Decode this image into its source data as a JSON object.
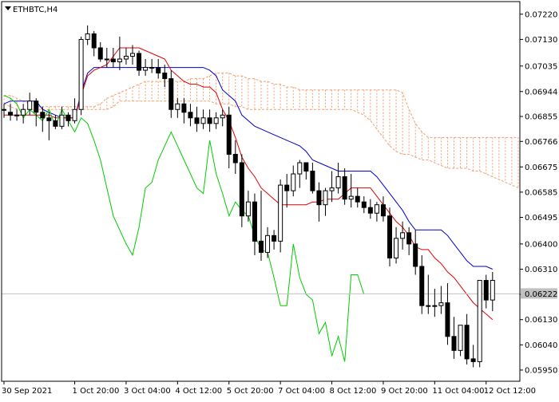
{
  "chart_data": {
    "type": "candlestick",
    "symbol_label": "ETHBTC,H4",
    "indicators": [
      "Ichimoku Kinko Hyo"
    ],
    "ylim": [
      0.0591,
      0.07265
    ],
    "y_ticks": [
      "0.07220",
      "0.07130",
      "0.07035",
      "0.06944",
      "0.06855",
      "0.06766",
      "0.06675",
      "0.06585",
      "0.06495",
      "0.06400",
      "0.06310",
      "0.06220",
      "0.06130",
      "0.06040",
      "0.05950"
    ],
    "x_ticks": [
      {
        "label": "30 Sep 2021",
        "bar": 0
      },
      {
        "label": "1 Oct 20:00",
        "bar": 11
      },
      {
        "label": "3 Oct 04:00",
        "bar": 19
      },
      {
        "label": "4 Oct 12:00",
        "bar": 27
      },
      {
        "label": "5 Oct 20:00",
        "bar": 35
      },
      {
        "label": "7 Oct 04:00",
        "bar": 43
      },
      {
        "label": "8 Oct 12:00",
        "bar": 51
      },
      {
        "label": "9 Oct 20:00",
        "bar": 59
      },
      {
        "label": "11 Oct 04:00",
        "bar": 67
      },
      {
        "label": "12 Oct 12:00",
        "bar": 75
      }
    ],
    "current_price": "0.06222",
    "candles": {
      "open": [
        0.0688,
        0.0687,
        0.0686,
        0.0686,
        0.0688,
        0.0691,
        0.0687,
        0.0685,
        0.0684,
        0.0682,
        0.0686,
        0.0684,
        0.0688,
        0.0713,
        0.0715,
        0.071,
        0.0706,
        0.0706,
        0.0705,
        0.0706,
        0.0707,
        0.0708,
        0.0702,
        0.0703,
        0.0703,
        0.0701,
        0.0699,
        0.0688,
        0.069,
        0.0687,
        0.0685,
        0.0683,
        0.0685,
        0.0683,
        0.0685,
        0.0686,
        0.0672,
        0.0669,
        0.065,
        0.0655,
        0.0641,
        0.0637,
        0.0643,
        0.0641,
        0.0661,
        0.0659,
        0.0665,
        0.0669,
        0.0666,
        0.0659,
        0.0654,
        0.0659,
        0.066,
        0.0664,
        0.0656,
        0.0657,
        0.0655,
        0.0653,
        0.0651,
        0.0654,
        0.065,
        0.0635,
        0.0642,
        0.0644,
        0.064,
        0.0632,
        0.0618,
        0.0618,
        0.0618,
        0.0619,
        0.0607,
        0.0602,
        0.0611,
        0.0599,
        0.0598,
        0.0627,
        0.062
      ],
      "close": [
        0.0688,
        0.0686,
        0.0686,
        0.0688,
        0.0691,
        0.0687,
        0.0685,
        0.0684,
        0.0682,
        0.0686,
        0.0684,
        0.0688,
        0.0713,
        0.0715,
        0.071,
        0.0706,
        0.0706,
        0.0705,
        0.0706,
        0.0707,
        0.0708,
        0.0702,
        0.0703,
        0.0703,
        0.0701,
        0.0699,
        0.0688,
        0.069,
        0.0687,
        0.0685,
        0.0683,
        0.0685,
        0.0683,
        0.0685,
        0.0686,
        0.0672,
        0.0669,
        0.065,
        0.0655,
        0.0641,
        0.0637,
        0.0643,
        0.0641,
        0.0661,
        0.0659,
        0.0665,
        0.0669,
        0.0666,
        0.0659,
        0.0654,
        0.0659,
        0.066,
        0.0664,
        0.0656,
        0.0657,
        0.0655,
        0.0653,
        0.0651,
        0.0654,
        0.065,
        0.0635,
        0.0642,
        0.0644,
        0.064,
        0.0632,
        0.0618,
        0.0618,
        0.0618,
        0.0619,
        0.0607,
        0.0602,
        0.0611,
        0.0599,
        0.0598,
        0.0627,
        0.062,
        0.0627
      ],
      "high": [
        0.069,
        0.069,
        0.0688,
        0.069,
        0.0694,
        0.0692,
        0.0689,
        0.0687,
        0.0686,
        0.0689,
        0.0687,
        0.0692,
        0.0714,
        0.0718,
        0.0716,
        0.0712,
        0.071,
        0.071,
        0.0714,
        0.071,
        0.0711,
        0.0709,
        0.0706,
        0.0706,
        0.0706,
        0.0704,
        0.0702,
        0.0692,
        0.0692,
        0.069,
        0.0689,
        0.0688,
        0.0688,
        0.0687,
        0.0688,
        0.0689,
        0.0677,
        0.0672,
        0.0659,
        0.0658,
        0.0659,
        0.0646,
        0.0645,
        0.0663,
        0.0665,
        0.0668,
        0.067,
        0.0669,
        0.0669,
        0.0662,
        0.066,
        0.0666,
        0.0669,
        0.0667,
        0.0665,
        0.066,
        0.0657,
        0.0656,
        0.0655,
        0.0657,
        0.0653,
        0.0646,
        0.0648,
        0.0646,
        0.0645,
        0.0636,
        0.0629,
        0.0624,
        0.0625,
        0.0626,
        0.0614,
        0.0608,
        0.0615,
        0.0604,
        0.0624,
        0.0629,
        0.063
      ],
      "low": [
        0.0685,
        0.0684,
        0.0684,
        0.0683,
        0.0686,
        0.0682,
        0.068,
        0.0677,
        0.0681,
        0.0681,
        0.0682,
        0.0683,
        0.0686,
        0.0711,
        0.0707,
        0.0705,
        0.0703,
        0.0703,
        0.0702,
        0.0704,
        0.0704,
        0.07,
        0.07,
        0.0701,
        0.0699,
        0.0696,
        0.0685,
        0.0685,
        0.0683,
        0.0682,
        0.068,
        0.0681,
        0.068,
        0.0681,
        0.0682,
        0.0667,
        0.0665,
        0.0646,
        0.0648,
        0.0636,
        0.0634,
        0.0635,
        0.0638,
        0.0637,
        0.0653,
        0.0657,
        0.066,
        0.0663,
        0.0658,
        0.0648,
        0.065,
        0.0655,
        0.0658,
        0.0654,
        0.0653,
        0.0653,
        0.0651,
        0.0649,
        0.0648,
        0.0648,
        0.0632,
        0.0633,
        0.0638,
        0.0636,
        0.0629,
        0.0615,
        0.0615,
        0.0614,
        0.0615,
        0.0604,
        0.0599,
        0.06,
        0.0597,
        0.0596,
        0.0596,
        0.0617,
        0.0616
      ]
    },
    "tenkan_sen": [
      0.0686,
      0.0686,
      0.0686,
      0.0686,
      0.0686,
      0.0686,
      0.0686,
      0.0686,
      0.0685,
      0.0685,
      0.0685,
      0.0685,
      0.0693,
      0.07,
      0.0702,
      0.0703,
      0.0704,
      0.0707,
      0.071,
      0.071,
      0.071,
      0.071,
      0.0709,
      0.0708,
      0.0707,
      0.0706,
      0.0702,
      0.07,
      0.0698,
      0.0697,
      0.0697,
      0.0696,
      0.0696,
      0.0694,
      0.0688,
      0.0684,
      0.0678,
      0.0671,
      0.0667,
      0.0664,
      0.066,
      0.0658,
      0.0656,
      0.0654,
      0.0654,
      0.0654,
      0.0654,
      0.0654,
      0.0655,
      0.0655,
      0.0656,
      0.0656,
      0.0656,
      0.0658,
      0.066,
      0.066,
      0.066,
      0.066,
      0.0657,
      0.0654,
      0.0651,
      0.0648,
      0.0646,
      0.0643,
      0.0639,
      0.0638,
      0.0638,
      0.0635,
      0.0633,
      0.063,
      0.0628,
      0.0625,
      0.0622,
      0.0619,
      0.0617,
      0.0615,
      0.0613
    ],
    "kijun_sen": [
      0.069,
      0.0691,
      0.0691,
      0.0691,
      0.0691,
      0.0691,
      0.0688,
      0.0687,
      0.0686,
      0.0685,
      0.0685,
      0.0685,
      0.0694,
      0.0701,
      0.0703,
      0.0703,
      0.0703,
      0.0703,
      0.0703,
      0.0703,
      0.0703,
      0.0703,
      0.0703,
      0.0703,
      0.0703,
      0.0703,
      0.0703,
      0.0703,
      0.0703,
      0.0703,
      0.0703,
      0.0703,
      0.0702,
      0.07,
      0.0695,
      0.0693,
      0.0691,
      0.0686,
      0.0684,
      0.0682,
      0.0681,
      0.068,
      0.0679,
      0.0678,
      0.0677,
      0.0676,
      0.0675,
      0.0673,
      0.067,
      0.0669,
      0.0668,
      0.0667,
      0.0666,
      0.0666,
      0.0666,
      0.0666,
      0.0666,
      0.0666,
      0.0664,
      0.0661,
      0.0658,
      0.0655,
      0.0652,
      0.0648,
      0.0645,
      0.0645,
      0.0645,
      0.0645,
      0.0645,
      0.0643,
      0.064,
      0.0637,
      0.0634,
      0.0632,
      0.0632,
      0.0632,
      0.0631
    ],
    "chikou_span": [
      [
        0.0693,
        0.0692,
        0.069,
        0.0685,
        0.0688,
        0.0686,
        0.0684,
        0.0688,
        0.0682,
        0.0688,
        0.0684,
        0.068,
        0.0685,
        0.0683,
        0.0677,
        0.067,
        0.066,
        0.065,
        0.0645,
        0.064,
        0.0636,
        0.0646,
        0.066,
        0.0662,
        0.067,
        0.0675,
        0.068,
        0.0675,
        0.067,
        0.0665,
        0.066,
        0.0658,
        0.0677,
        0.0665,
        0.0658,
        0.065,
        0.0655,
        0.0652,
        0.065,
        0.0643,
        0.0638,
        0.0637,
        0.0628,
        0.0618,
        0.0618,
        0.064,
        0.0628,
        0.0622,
        0.062,
        0.0608,
        0.0612,
        0.06,
        0.0607,
        0.0598,
        0.0629,
        0.0629,
        0.0622
      ],
      "offset_start_bar",
      0
    ],
    "senkou_span_a": [
      0.0688,
      0.0689,
      0.0689,
      0.0689,
      0.0689,
      0.0688,
      0.0687,
      0.0686,
      0.0686,
      0.0685,
      0.0685,
      0.0685,
      0.069,
      0.0693,
      0.0693,
      0.0693,
      0.0693,
      0.0693,
      0.0692,
      0.0692,
      0.0692,
      0.0692,
      0.0692,
      0.0692,
      0.0692,
      0.0692,
      0.0692,
      0.0694,
      0.0698,
      0.07,
      0.0701,
      0.0701,
      0.0701,
      0.0702,
      0.0703,
      0.0703,
      0.0703,
      0.0702,
      0.0701,
      0.07,
      0.07,
      0.07,
      0.07,
      0.0699,
      0.0697,
      0.0697,
      0.0697,
      0.0697,
      0.0697,
      0.0697,
      0.0697,
      0.0697,
      0.0697,
      0.0697,
      0.0697,
      0.0697,
      0.0697,
      0.0697,
      0.0697,
      0.0697,
      0.0697,
      0.0697,
      0.0697,
      0.0697,
      0.0697,
      0.0697,
      0.0697,
      0.0697,
      0.0697,
      0.0697,
      0.0697,
      0.0697,
      0.0697,
      0.0697,
      0.0697,
      0.0697,
      0.0697,
      0.0697,
      0.0697,
      0.0697,
      0.0697,
      0.0697,
      0.0697,
      0.0697,
      0.0697,
      0.0697,
      0.0697,
      0.0697,
      0.0697,
      0.0697,
      0.0697,
      0.0697,
      0.0697,
      0.0697,
      0.0697,
      0.0697,
      0.0697,
      0.0697,
      0.0697,
      0.0697,
      0.0697,
      0.0697,
      0.0697,
      0.0697,
      0.0697,
      0.0697
    ],
    "senkou_span_b": [
      0.0686,
      0.0686,
      0.0686,
      0.0686,
      0.0686,
      0.0686,
      0.0686,
      0.0686,
      0.0686,
      0.0686,
      0.0686,
      0.0687,
      0.0688,
      0.069,
      0.0691,
      0.0692,
      0.0693,
      0.0693,
      0.0693,
      0.0693,
      0.0693,
      0.0693,
      0.0693,
      0.0693,
      0.0693,
      0.0693,
      0.0693,
      0.0693,
      0.0693,
      0.0693,
      0.0693,
      0.0693,
      0.0693,
      0.0693,
      0.0693,
      0.0693,
      0.0693,
      0.0693,
      0.0693,
      0.0693,
      0.0693,
      0.0693,
      0.0693,
      0.0693,
      0.0693,
      0.0693,
      0.0693,
      0.0693,
      0.0693,
      0.0693,
      0.0693,
      0.0693,
      0.0693,
      0.0693,
      0.0693,
      0.0693,
      0.0693,
      0.0693,
      0.0693,
      0.0693,
      0.0693,
      0.0693,
      0.0693,
      0.0693,
      0.0693,
      0.0693,
      0.0693,
      0.0693,
      0.0693,
      0.0693,
      0.0693,
      0.0693,
      0.0693,
      0.0693,
      0.0693,
      0.0693,
      0.0693,
      0.0693,
      0.0693,
      0.0693,
      0.0693,
      0.0693,
      0.0693,
      0.0693,
      0.0693,
      0.0693,
      0.0693,
      0.0693,
      0.0693,
      0.0693,
      0.0693,
      0.0693,
      0.0693,
      0.0693,
      0.0693,
      0.0693,
      0.0693,
      0.0693,
      0.0693,
      0.0693,
      0.0693,
      0.0693,
      0.0693,
      0.0693,
      0.0693,
      0.0693
    ],
    "cloud_upper": [
      0.0693,
      0.0693,
      0.0692,
      0.0691,
      0.069,
      0.0689,
      0.0689,
      0.0689,
      0.0689,
      0.0689,
      0.0689,
      0.0689,
      0.0689,
      0.0689,
      0.0689,
      0.069,
      0.0692,
      0.0693,
      0.0694,
      0.0695,
      0.0696,
      0.0697,
      0.0698,
      0.0698,
      0.0698,
      0.0698,
      0.0698,
      0.0698,
      0.0698,
      0.0699,
      0.0699,
      0.0699,
      0.07,
      0.0701,
      0.0701,
      0.0701,
      0.07,
      0.07,
      0.0699,
      0.0699,
      0.0698,
      0.0698,
      0.0697,
      0.0697,
      0.0696,
      0.0696,
      0.0695,
      0.0695,
      0.0695,
      0.0695,
      0.0695,
      0.0695,
      0.0695,
      0.0695,
      0.0695,
      0.0695,
      0.0695,
      0.0695,
      0.0695,
      0.0695,
      0.0695,
      0.0695,
      0.0694,
      0.0688,
      0.0683,
      0.068,
      0.0678,
      0.0678,
      0.0678,
      0.0678,
      0.0678,
      0.0678,
      0.0678,
      0.0678,
      0.0678,
      0.0678,
      0.0678,
      0.0678,
      0.0678,
      0.0678,
      0.0678
    ],
    "cloud_lower": [
      0.069,
      0.0689,
      0.0688,
      0.0688,
      0.0688,
      0.0688,
      0.0688,
      0.0688,
      0.0688,
      0.0688,
      0.0688,
      0.0688,
      0.0688,
      0.0688,
      0.0688,
      0.0688,
      0.0688,
      0.0689,
      0.0691,
      0.0691,
      0.0691,
      0.0691,
      0.0691,
      0.0691,
      0.0691,
      0.0691,
      0.0691,
      0.0691,
      0.0691,
      0.0691,
      0.0691,
      0.0691,
      0.0691,
      0.069,
      0.069,
      0.069,
      0.0689,
      0.0689,
      0.0688,
      0.0688,
      0.0688,
      0.0688,
      0.0688,
      0.0688,
      0.0688,
      0.0688,
      0.0688,
      0.0688,
      0.0688,
      0.0688,
      0.0688,
      0.0688,
      0.0688,
      0.0688,
      0.0688,
      0.0687,
      0.0686,
      0.0684,
      0.0681,
      0.0678,
      0.0675,
      0.0673,
      0.0672,
      0.0672,
      0.0671,
      0.067,
      0.067,
      0.0669,
      0.0668,
      0.0667,
      0.0667,
      0.0667,
      0.0667,
      0.0666,
      0.0666,
      0.0665,
      0.0664,
      0.0663,
      0.0662,
      0.0661,
      0.066,
      0.066,
      0.066,
      0.066,
      0.066,
      0.0659,
      0.0659,
      0.0659,
      0.0659,
      0.0659
    ],
    "colors": {
      "bull_body": "#ffffff",
      "bear_body": "#000000",
      "tenkan": "#e00000",
      "kijun": "#0000cc",
      "chikou": "#00cc00",
      "cloud": "#f0a070",
      "grid": "#c8c8c8",
      "frame": "#000000"
    },
    "grid": false,
    "legend": "none"
  }
}
